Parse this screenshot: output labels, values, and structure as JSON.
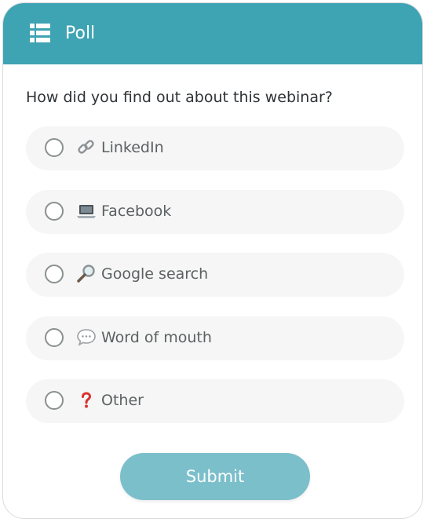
{
  "header": {
    "title": "Poll",
    "icon": "list-icon",
    "background_color": "#3ea3b3"
  },
  "question": "How did you find out about this webinar?",
  "options": [
    {
      "label": "LinkedIn",
      "icon": "link-icon",
      "selected": false
    },
    {
      "label": "Facebook",
      "icon": "laptop-icon",
      "selected": false
    },
    {
      "label": "Google search",
      "icon": "magnifier-icon",
      "selected": false
    },
    {
      "label": "Word of mouth",
      "icon": "speech-bubble-icon",
      "selected": false
    },
    {
      "label": "Other",
      "icon": "question-mark-icon",
      "selected": false
    }
  ],
  "submit": {
    "label": "Submit",
    "background_color": "#7bbfcb"
  },
  "colors": {
    "option_background": "#f5f6f5",
    "question_text": "#2f3336",
    "option_text": "#5c6163"
  }
}
